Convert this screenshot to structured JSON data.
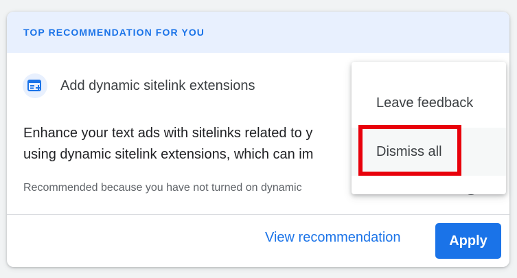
{
  "card": {
    "header_title": "TOP RECOMMENDATION FOR YOU",
    "recommendation": {
      "title": "Add dynamic sitelink extensions",
      "icon": "sitelink-add-icon",
      "description_line1": "Enhance your text ads with sitelinks related to y",
      "description_line2": "using dynamic sitelink extensions, which can im",
      "reason": "Recommended because you have not turned on dynamic"
    },
    "actions": {
      "view_label": "View recommendation",
      "apply_label": "Apply"
    }
  },
  "menu": {
    "items": [
      {
        "label": "Leave feedback"
      },
      {
        "label": "Dismiss all"
      }
    ]
  },
  "colors": {
    "accent": "#1a73e8",
    "header_bg": "#e8f0fe",
    "highlight": "#e8000b"
  }
}
